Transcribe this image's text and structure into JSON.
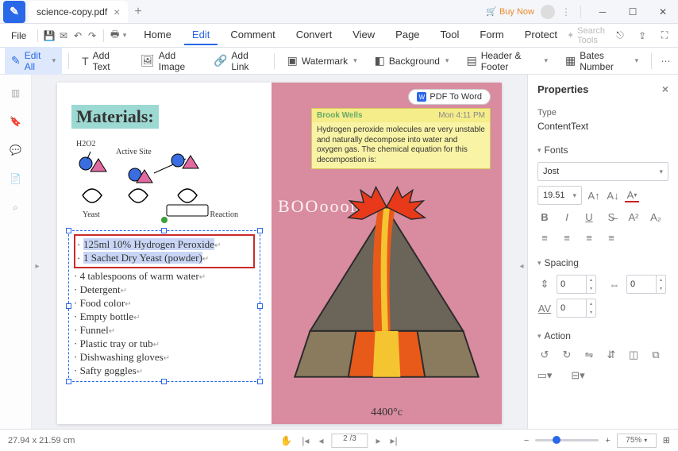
{
  "titlebar": {
    "filename": "science-copy.pdf",
    "buy_now": "Buy Now"
  },
  "menubar": {
    "file": "File",
    "tabs": [
      "Home",
      "Edit",
      "Comment",
      "Convert",
      "View",
      "Page",
      "Tool",
      "Form",
      "Protect"
    ],
    "active_index": 1,
    "search_placeholder": "Search Tools"
  },
  "toolbar": {
    "edit_all": "Edit All",
    "add_text": "Add Text",
    "add_image": "Add Image",
    "add_link": "Add Link",
    "watermark": "Watermark",
    "background": "Background",
    "header_footer": "Header & Footer",
    "bates_number": "Bates Number"
  },
  "document": {
    "pdf_to_word": "PDF To Word",
    "materials_title": "Materials:",
    "diagram": {
      "h2o2": "H2O2",
      "active_site": "Active Site",
      "yeast": "Yeast",
      "reaction": "Reaction"
    },
    "selected_lines": [
      "125ml 10% Hydrogen Peroxide",
      "1 Sachet Dry Yeast (powder)"
    ],
    "list_items": [
      "4 tablespoons of warm water",
      "Detergent",
      "Food color",
      "Empty bottle",
      "Funnel",
      "Plastic tray or tub",
      "Dishwashing gloves",
      "Safty goggles"
    ],
    "sticky": {
      "author": "Brook Wells",
      "time": "Mon 4:11 PM",
      "body": "Hydrogen peroxide molecules are very unstable and naturally decompose into water and oxygen gas. The chemical equation for this decompostion is:"
    },
    "boom": "BOOooom!",
    "temp": "4400°c"
  },
  "properties": {
    "title": "Properties",
    "type_label": "Type",
    "type_value": "ContentText",
    "fonts_label": "Fonts",
    "font_name": "Jost",
    "font_size": "19.51",
    "spacing_label": "Spacing",
    "spacing_val1": "0",
    "spacing_val2": "0",
    "spacing_val3": "0",
    "action_label": "Action"
  },
  "statusbar": {
    "dimensions": "27.94 x 21.59 cm",
    "page": "2 /3",
    "zoom": "75%"
  }
}
